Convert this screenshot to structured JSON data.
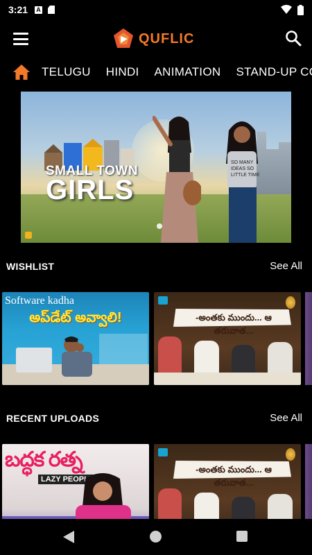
{
  "status_bar": {
    "time": "3:21",
    "icons": [
      "a-notification-icon",
      "sd-card-icon",
      "wifi-icon",
      "battery-icon"
    ]
  },
  "header": {
    "logo_text": "QUFLIC",
    "brand_color": "#f47a2a",
    "menu_icon": "hamburger-menu-icon",
    "search_icon": "search-icon"
  },
  "tabs": {
    "home_icon": "home-icon",
    "items": [
      "TELUGU",
      "HINDI",
      "ANIMATION",
      "STAND-UP COMEDY"
    ]
  },
  "banner": {
    "title_small": "SMALL TOWN",
    "title_large": "GIRLS",
    "shirt_text": "SO MANY IDEAS SO LITTLE TIME"
  },
  "sections": {
    "wishlist": {
      "title": "WISHLIST",
      "see_all": "See All",
      "items": [
        {
          "heading": "Software kadha",
          "telugu": "అప్‌డేట్ అవ్వాలి!"
        },
        {
          "telugu": "-అంతకు ముందు... ఆ తరువాత..."
        }
      ]
    },
    "recent_uploads": {
      "title": "RECENT UPLOADS",
      "see_all": "See All",
      "items": [
        {
          "telugu": "బద్ధక రత్న",
          "subtitle": "LAZY PEOPLE"
        },
        {
          "telugu": "-అంతకు ముందు... ఆ తరువాత..."
        }
      ]
    }
  },
  "nav_bar": {
    "back": "back-icon",
    "home": "home-circle-icon",
    "recents": "recents-square-icon"
  }
}
